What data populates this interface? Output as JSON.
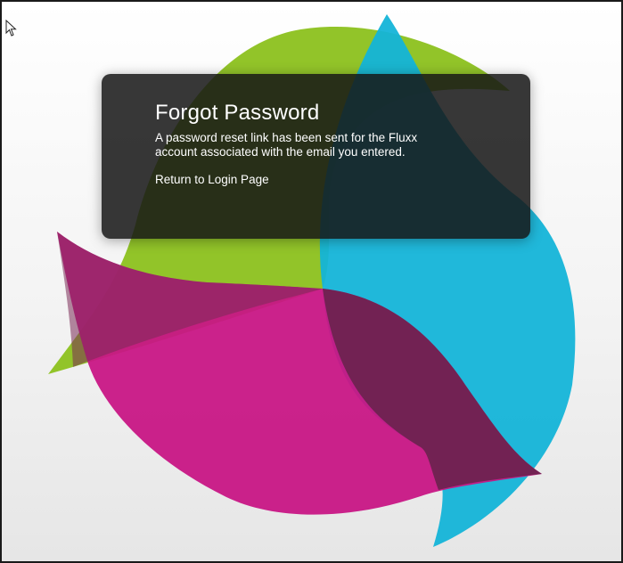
{
  "dialog": {
    "title": "Forgot Password",
    "message": "A password reset link has been sent for the Fluxx account associated with the email you entered.",
    "return_link": "Return to Login Page"
  },
  "colors": {
    "green": "#8cc11e",
    "cyan": "#14b4d8",
    "magenta": "#c81685",
    "overlap": "#6e2350",
    "dialog_bg": "#161616"
  },
  "icons": {
    "cursor": "arrow-cursor-icon"
  }
}
